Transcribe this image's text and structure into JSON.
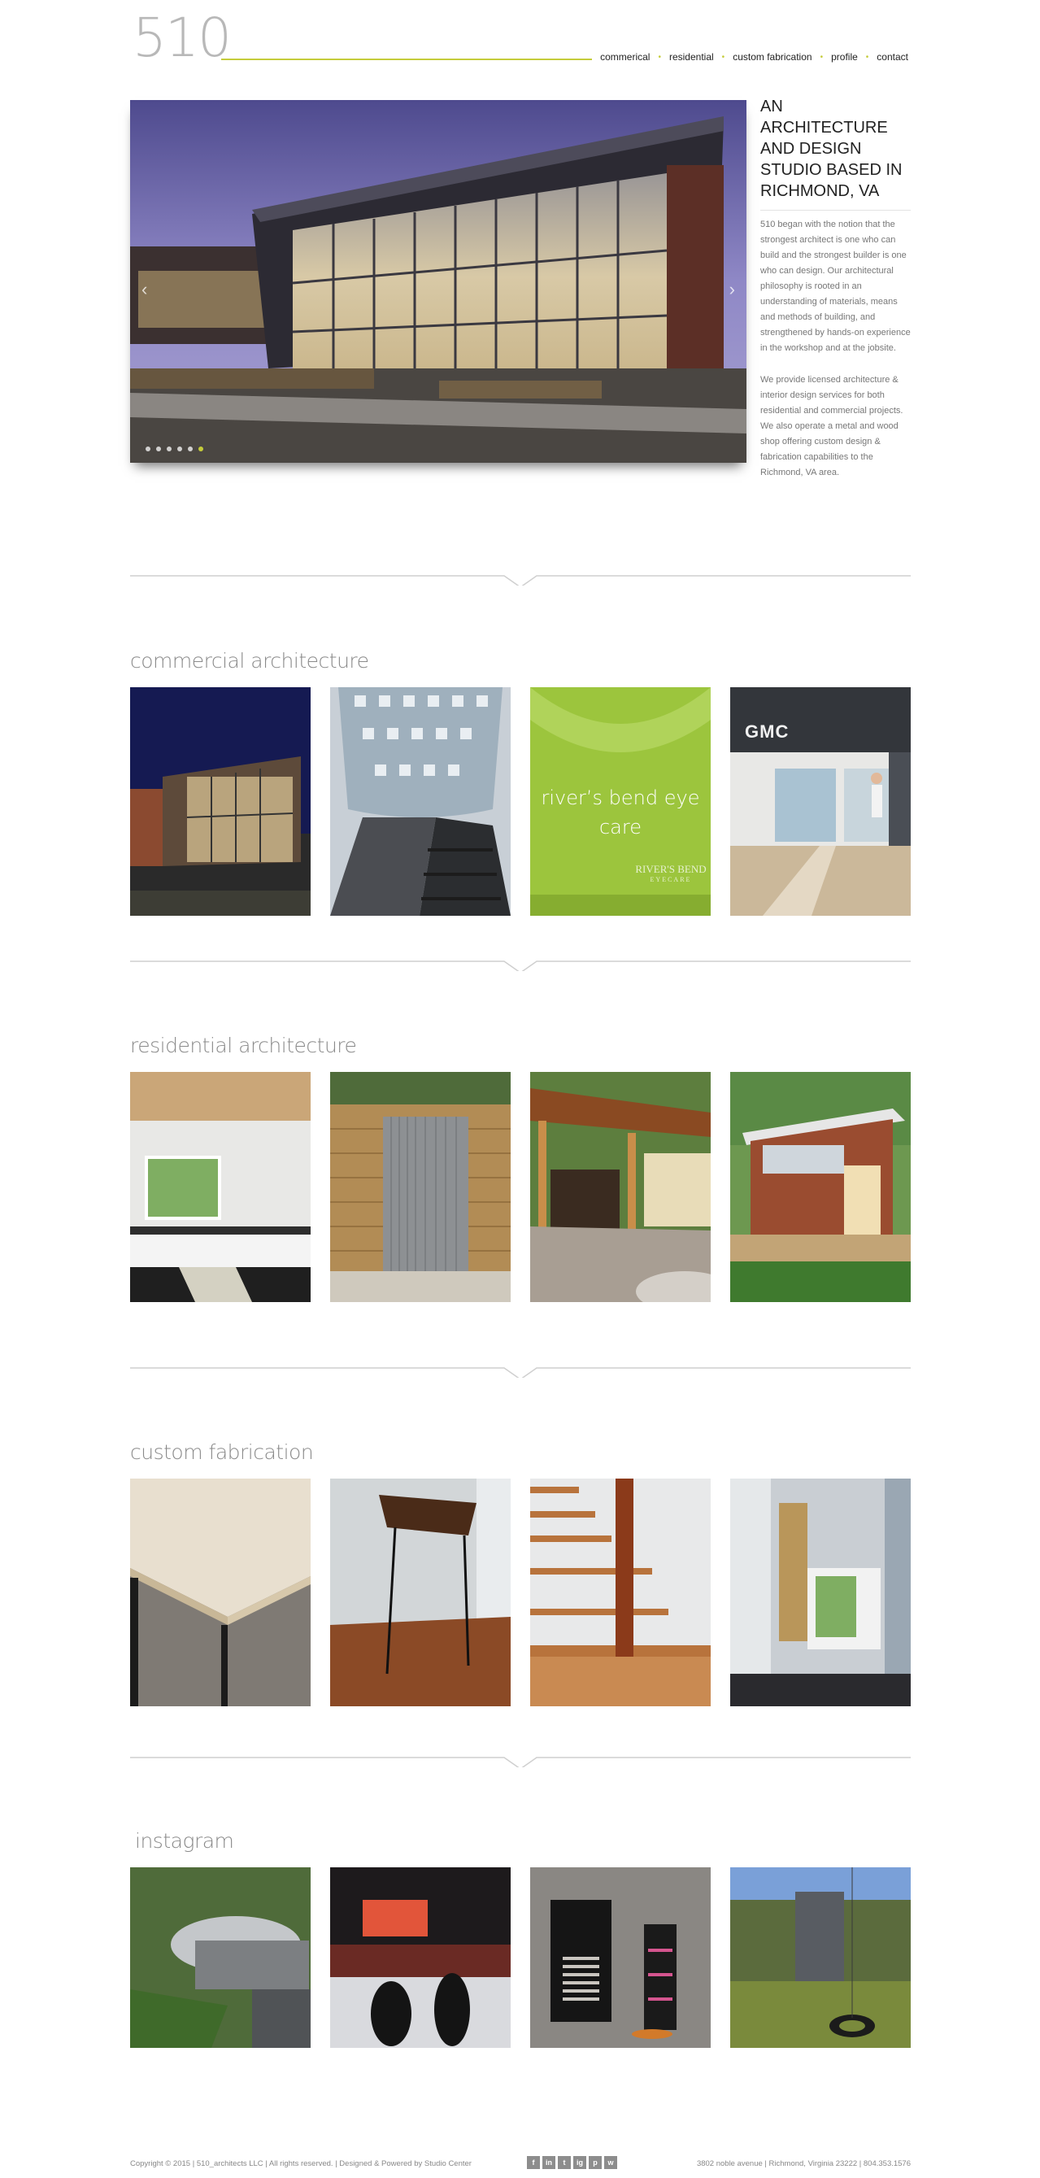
{
  "header": {
    "logo": "510",
    "nav": [
      "commerical",
      "residential",
      "custom fabrication",
      "profile",
      "contact"
    ]
  },
  "hero": {
    "slides": 6,
    "active_slide": 5,
    "prev_icon": "chevron-left-icon",
    "next_icon": "chevron-right-icon"
  },
  "intro": {
    "heading": "AN ARCHITECTURE AND DESIGN STUDIO BASED IN RICHMOND, VA",
    "paragraph1": "510 began with the notion that the strongest architect is one who can build and the strongest builder is one who can design. Our architectural philosophy is rooted in an understanding of materials, means and methods of building, and strengthened by hands-on experience in the workshop and at the jobsite.",
    "paragraph2": "We provide licensed architecture & interior design services for both residential and commercial projects. We also operate a metal and wood shop offering custom design & fabrication capabilities to the Richmond, VA area."
  },
  "sections": {
    "commercial": {
      "title": "commercial architecture",
      "tile3_label": "river’s bend eye care",
      "tile3_brand": "RIVER'S BEND",
      "tile3_brand_sub": "EYECARE",
      "tile4_sign": "GMC"
    },
    "residential": {
      "title": "residential architecture"
    },
    "fabrication": {
      "title": "custom fabrication"
    },
    "instagram": {
      "title": "instagram"
    }
  },
  "footer": {
    "copyright": "Copyright © 2015 | 510_architects LLC | All rights reserved.  |  Designed & Powered by Studio Center",
    "social": [
      "f",
      "in",
      "t",
      "ig",
      "p",
      "w"
    ],
    "address": "3802 noble avenue    |    Richmond, Virginia 23222    |    804.353.1576"
  },
  "colors": {
    "accent": "#c5cc3a",
    "title_gray": "#8a8a8a",
    "divider": "#cfcfcf"
  }
}
